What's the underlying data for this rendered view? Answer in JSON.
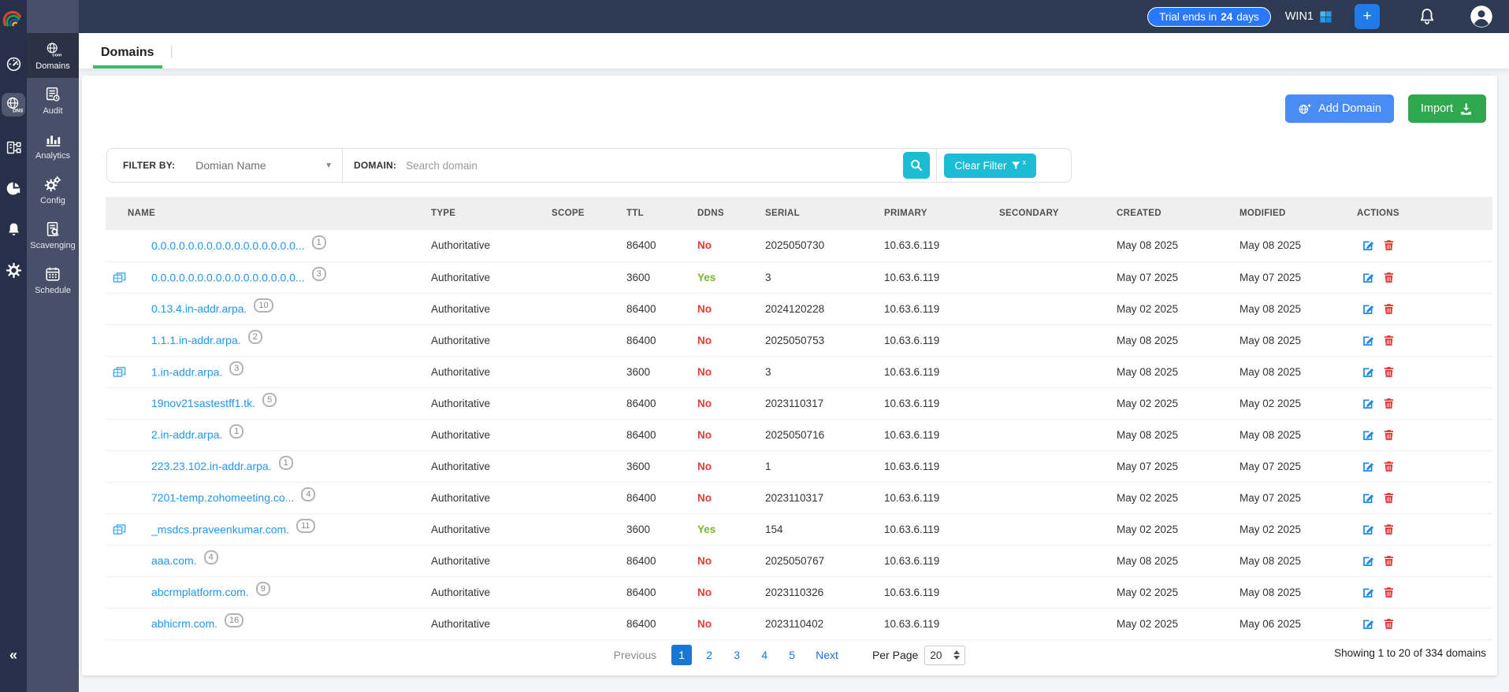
{
  "topbar": {
    "trial_prefix": "Trial ends in",
    "trial_days": "24",
    "trial_suffix": "days",
    "server_name": "WIN1",
    "add_label": "+"
  },
  "rail": {
    "items": [
      "dashboard",
      "dns",
      "network-topology",
      "reports",
      "alerts",
      "settings"
    ],
    "active_item": "dns",
    "collapse_label": "«"
  },
  "sidebar": {
    "items": [
      {
        "label": "Domains",
        "active": true
      },
      {
        "label": "Audit",
        "active": false
      },
      {
        "label": "Analytics",
        "active": false
      },
      {
        "label": "Config",
        "active": false
      },
      {
        "label": "Scavenging",
        "active": false
      },
      {
        "label": "Schedule",
        "active": false
      }
    ]
  },
  "tab": {
    "label": "Domains"
  },
  "toolbar": {
    "add_domain_label": "Add Domain",
    "import_label": "Import"
  },
  "filter": {
    "filter_by_label": "FILTER BY:",
    "filter_by_value": "Domian Name",
    "domain_label": "DOMAIN:",
    "search_placeholder": "Search domain",
    "clear_filter_label": "Clear Filter",
    "clear_filter_x": "x"
  },
  "table": {
    "columns": [
      "NAME",
      "TYPE",
      "SCOPE",
      "TTL",
      "DDNS",
      "SERIAL",
      "PRIMARY",
      "SECONDARY",
      "CREATED",
      "MODIFIED",
      "ACTIONS"
    ],
    "rows": [
      {
        "subzone": false,
        "name": "0.0.0.0.0.0.0.0.0.0.0.0.0.0.0.0...",
        "count": "1",
        "type": "Authoritative",
        "scope": "",
        "ttl": "86400",
        "ddns": "No",
        "serial": "2025050730",
        "primary": "10.63.6.119",
        "secondary": "",
        "created": "May 08 2025",
        "modified": "May 08 2025"
      },
      {
        "subzone": true,
        "name": "0.0.0.0.0.0.0.0.0.0.0.0.0.0.0.0...",
        "count": "3",
        "type": "Authoritative",
        "scope": "",
        "ttl": "3600",
        "ddns": "Yes",
        "serial": "3",
        "primary": "10.63.6.119",
        "secondary": "",
        "created": "May 07 2025",
        "modified": "May 07 2025"
      },
      {
        "subzone": false,
        "name": "0.13.4.in-addr.arpa.",
        "count": "10",
        "type": "Authoritative",
        "scope": "",
        "ttl": "86400",
        "ddns": "No",
        "serial": "2024120228",
        "primary": "10.63.6.119",
        "secondary": "",
        "created": "May 02 2025",
        "modified": "May 08 2025"
      },
      {
        "subzone": false,
        "name": "1.1.1.in-addr.arpa.",
        "count": "2",
        "type": "Authoritative",
        "scope": "",
        "ttl": "86400",
        "ddns": "No",
        "serial": "2025050753",
        "primary": "10.63.6.119",
        "secondary": "",
        "created": "May 08 2025",
        "modified": "May 08 2025"
      },
      {
        "subzone": true,
        "name": "1.in-addr.arpa.",
        "count": "3",
        "type": "Authoritative",
        "scope": "",
        "ttl": "3600",
        "ddns": "No",
        "serial": "3",
        "primary": "10.63.6.119",
        "secondary": "",
        "created": "May 08 2025",
        "modified": "May 08 2025"
      },
      {
        "subzone": false,
        "name": "19nov21sastestff1.tk.",
        "count": "5",
        "type": "Authoritative",
        "scope": "",
        "ttl": "86400",
        "ddns": "No",
        "serial": "2023110317",
        "primary": "10.63.6.119",
        "secondary": "",
        "created": "May 02 2025",
        "modified": "May 02 2025"
      },
      {
        "subzone": false,
        "name": "2.in-addr.arpa.",
        "count": "1",
        "type": "Authoritative",
        "scope": "",
        "ttl": "86400",
        "ddns": "No",
        "serial": "2025050716",
        "primary": "10.63.6.119",
        "secondary": "",
        "created": "May 08 2025",
        "modified": "May 08 2025"
      },
      {
        "subzone": false,
        "name": "223.23.102.in-addr.arpa.",
        "count": "1",
        "type": "Authoritative",
        "scope": "",
        "ttl": "3600",
        "ddns": "No",
        "serial": "1",
        "primary": "10.63.6.119",
        "secondary": "",
        "created": "May 07 2025",
        "modified": "May 07 2025"
      },
      {
        "subzone": false,
        "name": "7201-temp.zohomeeting.co...",
        "count": "4",
        "type": "Authoritative",
        "scope": "",
        "ttl": "86400",
        "ddns": "No",
        "serial": "2023110317",
        "primary": "10.63.6.119",
        "secondary": "",
        "created": "May 02 2025",
        "modified": "May 07 2025"
      },
      {
        "subzone": true,
        "name": "_msdcs.praveenkumar.com.",
        "count": "11",
        "type": "Authoritative",
        "scope": "",
        "ttl": "3600",
        "ddns": "Yes",
        "serial": "154",
        "primary": "10.63.6.119",
        "secondary": "",
        "created": "May 02 2025",
        "modified": "May 02 2025"
      },
      {
        "subzone": false,
        "name": "aaa.com.",
        "count": "4",
        "type": "Authoritative",
        "scope": "",
        "ttl": "86400",
        "ddns": "No",
        "serial": "2025050767",
        "primary": "10.63.6.119",
        "secondary": "",
        "created": "May 08 2025",
        "modified": "May 08 2025"
      },
      {
        "subzone": false,
        "name": "abcrmplatform.com.",
        "count": "9",
        "type": "Authoritative",
        "scope": "",
        "ttl": "86400",
        "ddns": "No",
        "serial": "2023110326",
        "primary": "10.63.6.119",
        "secondary": "",
        "created": "May 02 2025",
        "modified": "May 08 2025"
      },
      {
        "subzone": false,
        "name": "abhicrm.com.",
        "count": "16",
        "type": "Authoritative",
        "scope": "",
        "ttl": "86400",
        "ddns": "No",
        "serial": "2023110402",
        "primary": "10.63.6.119",
        "secondary": "",
        "created": "May 02 2025",
        "modified": "May 06 2025"
      }
    ]
  },
  "pagination": {
    "previous_label": "Previous",
    "pages": [
      "1",
      "2",
      "3",
      "4",
      "5"
    ],
    "active_page": "1",
    "next_label": "Next",
    "per_page_label": "Per Page",
    "per_page_value": "20",
    "summary": "Showing 1 to 20 of 334 domains"
  },
  "colors": {
    "topbar_navy": "#2d3a52",
    "rail_dark": "#273049",
    "sidebar_slate": "#475068",
    "tab_underline_green": "#3fba68",
    "accent_cyan": "#1cbcd4",
    "link_blue": "#2196f3",
    "ddns_no_red": "#e53935",
    "ddns_yes_green": "#76b82a",
    "add_domain_blue": "#4a8cf5",
    "import_green": "#2fa84f",
    "active_page_blue": "#1877d2",
    "trial_pill_blue": "#2979ff"
  }
}
